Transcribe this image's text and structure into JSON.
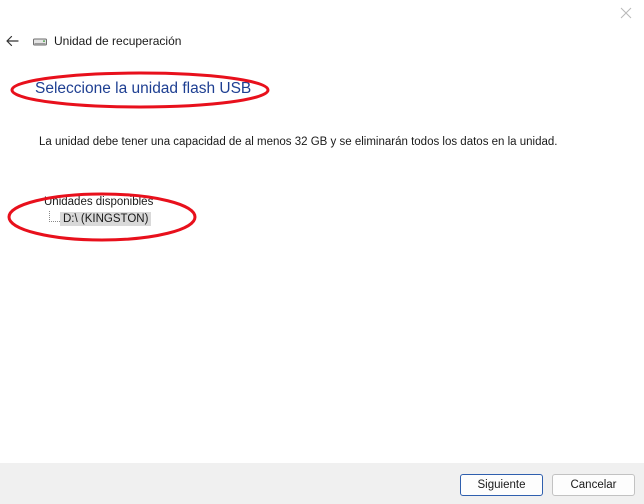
{
  "window": {
    "title": "Unidad de recuperación"
  },
  "page": {
    "heading": "Seleccione la unidad flash USB",
    "description": "La unidad debe tener una capacidad de al menos 32 GB y se eliminarán todos los datos en la unidad."
  },
  "drives": {
    "label": "Unidades disponibles",
    "items": [
      {
        "label": "D:\\ (KINGSTON)",
        "selected": true
      }
    ]
  },
  "buttons": {
    "next": "Siguiente",
    "cancel": "Cancelar"
  },
  "colors": {
    "heading": "#1e3f92",
    "annotation": "#e8101c",
    "selection": "#d9d9d9",
    "footer": "#f0f0f0"
  },
  "icons": {
    "close": "close-icon",
    "back": "back-arrow-icon",
    "drive": "drive-icon"
  }
}
